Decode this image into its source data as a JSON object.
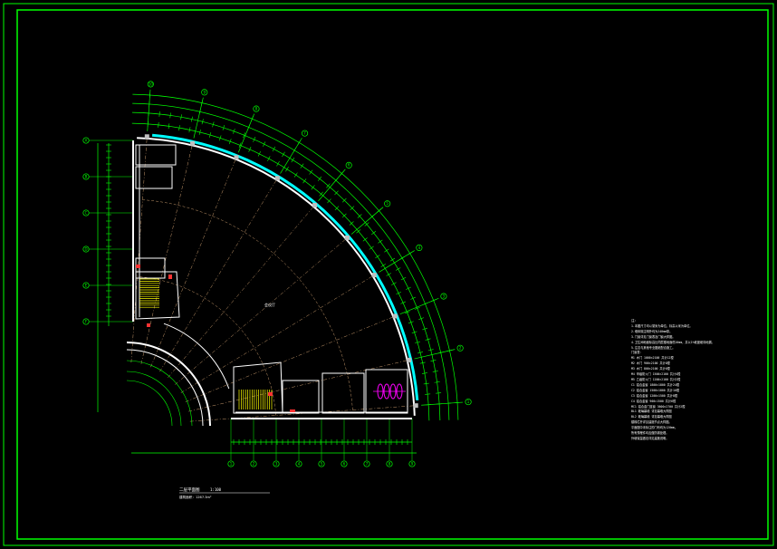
{
  "drawing": {
    "colors": {
      "background": "#000000",
      "frame": "#00ff00",
      "wall": "#ffffff",
      "glass_band": "#00ffff",
      "dimension": "#00ff00",
      "axis": "#c89b6d",
      "stair": "#ffff00",
      "fixture": "#ff00ff",
      "hatch": "#ff3333"
    },
    "radial_axis_labels": [
      "1",
      "2",
      "3",
      "4",
      "5",
      "6",
      "7",
      "8",
      "9",
      "10"
    ],
    "left_axis_labels": [
      "A",
      "B",
      "C",
      "D",
      "E",
      "F"
    ],
    "bottom_axis_labels": [
      "1",
      "2",
      "3",
      "4",
      "5",
      "6",
      "7",
      "8",
      "9"
    ],
    "room_label": "会议厅",
    "caption": "二层平面图",
    "caption_scale": "1:100",
    "caption_area": "建筑面积：1267.3m²"
  },
  "notes": {
    "title": "注：",
    "lines": [
      "1.本图尺寸均以毫米为单位，标高以米为单位。",
      "2.墙体除注明外均为240mm厚。",
      "3.门窗详见门窗表及门窗大样图。",
      "4.卫生间地面标高比同层楼地面低20mm，并以1%坡度坡向地漏。",
      "5.注意与其他专业图纸配合施工。",
      "门窗表：",
      "M1 木门 1000×2100 共计12樘",
      "M2 木门 900×2100 共计8樘",
      "M3 木门 800×2100 共计6樘",
      "M4 甲级防火门 1500×2100 共计4樘",
      "M5 乙级防火门 1200×2100 共计2樘",
      "C1 铝合金窗 1800×1800 共计24樘",
      "C2 铝合金窗 1500×1800 共计10樘",
      "C3 铝合金窗 1200×1500 共计8樘",
      "C4 铝合金窗 900×1500 共计6樘",
      "MC1 铝合金门连窗 3600×2700 共计2樘",
      "BL1 玻璃幕墙 详见幕墙大样图",
      "BL2 玻璃幕墙 详见幕墙大样图",
      "楼梯栏杆详见建施节点大样图。",
      "平面图中未标注的门垳均为120mm。",
      "所有预埋件均应做防锈处理。",
      "外墙保温做法详见建施说明。"
    ]
  }
}
